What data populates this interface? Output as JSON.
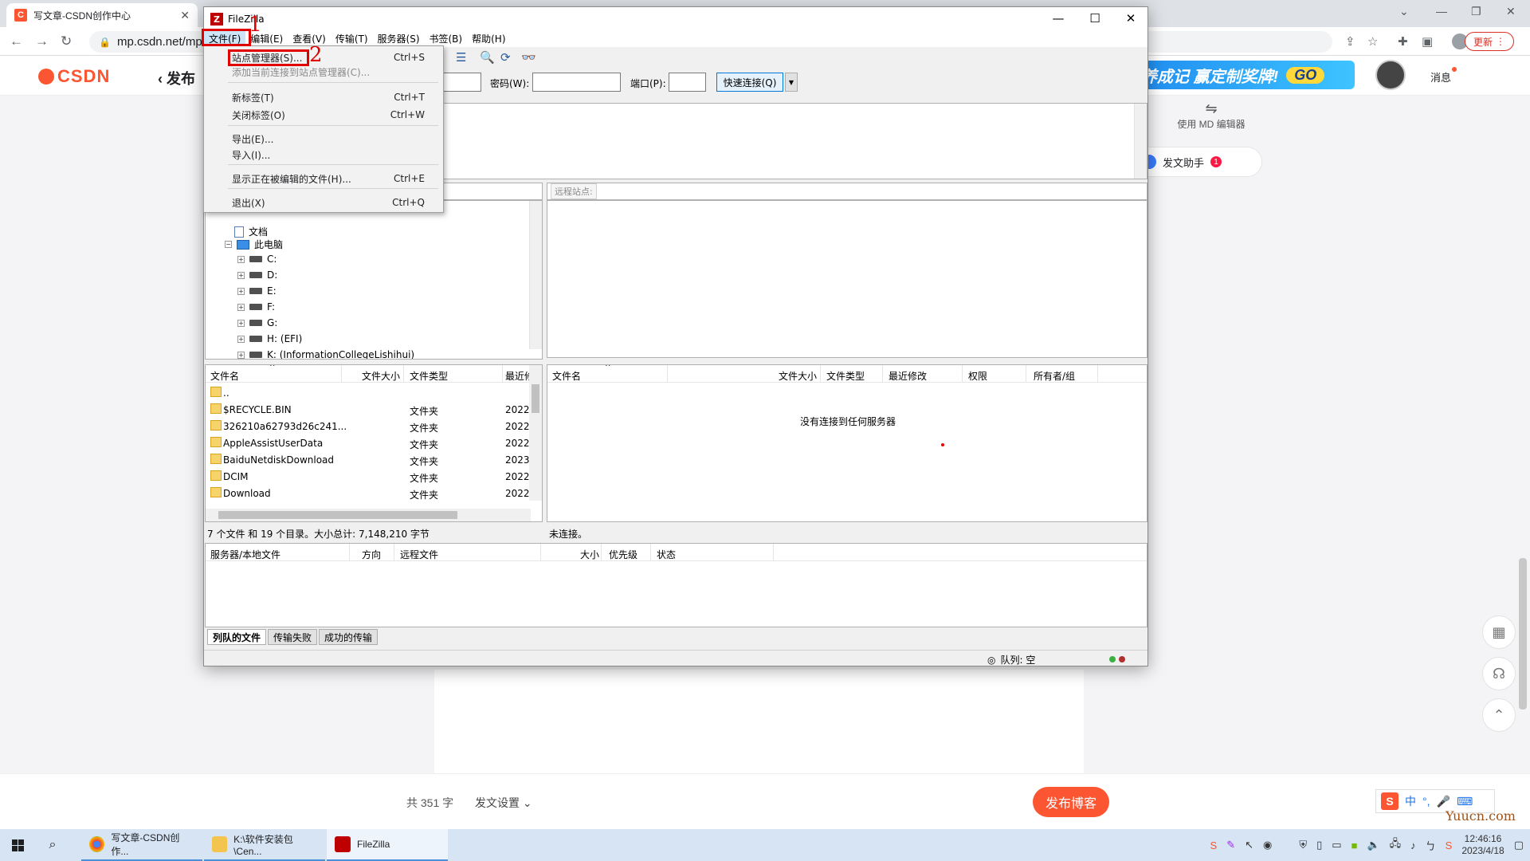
{
  "browser": {
    "tab_title": "写文章-CSDN创作中心",
    "url": "mp.csdn.net/mp",
    "update_label": "更新"
  },
  "csdn": {
    "logo": "CSDN",
    "page_title": "发布",
    "banner_text": "养成记 赢定制奖牌!",
    "banner_go": "GO",
    "messages": "消息",
    "md_editor": "使用 MD 编辑器",
    "assistant": "发文助手",
    "assistant_badge": "1",
    "word_count": "共 351 字",
    "settings": "发文设置",
    "publish": "发布博客",
    "ime": "中",
    "watermark": "Yuucn.com"
  },
  "filezilla": {
    "title": "FileZilla",
    "menus": [
      "文件(F)",
      "编辑(E)",
      "查看(V)",
      "传输(T)",
      "服务器(S)",
      "书签(B)",
      "帮助(H)"
    ],
    "quickconnect": {
      "password_label": "密码(W):",
      "port_label": "端口(P):",
      "connect_button": "快速连接(Q)"
    },
    "remote_site_label": "远程站点:",
    "local_tree": [
      {
        "label": "文档",
        "type": "doc"
      },
      {
        "label": "此电脑",
        "type": "pc"
      },
      {
        "label": "C:",
        "type": "drive"
      },
      {
        "label": "D:",
        "type": "drive"
      },
      {
        "label": "E:",
        "type": "drive"
      },
      {
        "label": "F:",
        "type": "drive"
      },
      {
        "label": "G:",
        "type": "drive"
      },
      {
        "label": "H: (EFI)",
        "type": "drive"
      },
      {
        "label": "K: (InformationCollegeLishihui)",
        "type": "drive"
      }
    ],
    "local_columns": [
      "文件名",
      "文件大小",
      "文件类型",
      "最近修"
    ],
    "local_files": [
      {
        "name": "..",
        "type": "",
        "date": ""
      },
      {
        "name": "$RECYCLE.BIN",
        "type": "文件夹",
        "date": "2022"
      },
      {
        "name": "326210a62793d26c241...",
        "type": "文件夹",
        "date": "2022"
      },
      {
        "name": "AppleAssistUserData",
        "type": "文件夹",
        "date": "2022"
      },
      {
        "name": "BaiduNetdiskDownload",
        "type": "文件夹",
        "date": "2023"
      },
      {
        "name": "DCIM",
        "type": "文件夹",
        "date": "2022"
      },
      {
        "name": "Download",
        "type": "文件夹",
        "date": "2022"
      }
    ],
    "remote_columns": [
      "文件名",
      "文件大小",
      "文件类型",
      "最近修改",
      "权限",
      "所有者/组"
    ],
    "no_connection": "没有连接到任何服务器",
    "local_status": "7 个文件 和 19 个目录。大小总计: 7,148,210 字节",
    "remote_status": "未连接。",
    "queue_columns": [
      "服务器/本地文件",
      "方向",
      "远程文件",
      "大小",
      "优先级",
      "状态"
    ],
    "queue_tabs": [
      "列队的文件",
      "传输失败",
      "成功的传输"
    ],
    "queue_status": "队列: 空",
    "file_menu": [
      {
        "label": "站点管理器(S)...",
        "shortcut": "Ctrl+S",
        "disabled": false
      },
      {
        "label": "添加当前连接到站点管理器(C)...",
        "shortcut": "",
        "disabled": true
      },
      {
        "label": "新标签(T)",
        "shortcut": "Ctrl+T",
        "disabled": false
      },
      {
        "label": "关闭标签(O)",
        "shortcut": "Ctrl+W",
        "disabled": false
      },
      {
        "label": "导出(E)...",
        "shortcut": "",
        "disabled": false
      },
      {
        "label": "导入(I)...",
        "shortcut": "",
        "disabled": false
      },
      {
        "label": "显示正在被编辑的文件(H)...",
        "shortcut": "Ctrl+E",
        "disabled": false
      },
      {
        "label": "退出(X)",
        "shortcut": "Ctrl+Q",
        "disabled": false
      }
    ],
    "annotations": [
      "1",
      "2"
    ]
  },
  "taskbar": {
    "apps": [
      {
        "label": "写文章-CSDN创作...",
        "icon": "chrome-icon"
      },
      {
        "label": "K:\\软件安装包\\Cen...",
        "icon": "folder-icon"
      },
      {
        "label": "FileZilla",
        "icon": "filezilla-icon"
      }
    ],
    "time": "12:46:16",
    "date": "2023/4/18"
  },
  "colors": {
    "csdn_red": "#fc5531",
    "fz_red": "#bf0000",
    "annotation_red": "#e00000"
  }
}
